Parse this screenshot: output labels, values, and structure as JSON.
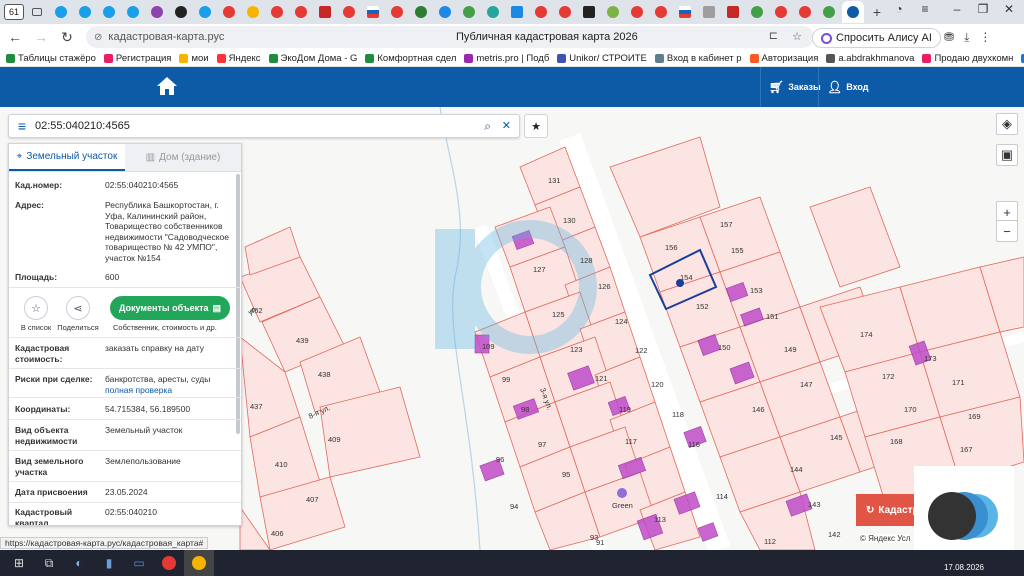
{
  "browser": {
    "tab_count": "61",
    "page_title": "Публичная кадастровая карта 2026",
    "url": "кадастровая-карта.рус",
    "alice_button": "Спросить Алису AI",
    "status_url": "https://кадастровая-карта.рус/кадастровая_карта#"
  },
  "bookmarks": [
    {
      "label": "Таблицы стажёро",
      "color": "#1e8e3e"
    },
    {
      "label": "Регистрация",
      "color": "#e91e63"
    },
    {
      "label": "мои",
      "color": "#f4b400"
    },
    {
      "label": "Яндекс",
      "color": "#ff3333"
    },
    {
      "label": "ЭкоДом Дома - G",
      "color": "#1e8e3e"
    },
    {
      "label": "Комфортная сдел",
      "color": "#1e8e3e"
    },
    {
      "label": "metris.pro | Подб",
      "color": "#9c27b0"
    },
    {
      "label": "Unikor/ СТРОИТЕ",
      "color": "#3f51b5"
    },
    {
      "label": "Вход в кабинет р",
      "color": "#607d8b"
    },
    {
      "label": "Авторизация",
      "color": "#ff5722"
    },
    {
      "label": "a.abdrakhmanova",
      "color": "#555555"
    },
    {
      "label": "Продаю двухкомн",
      "color": "#e91e63"
    },
    {
      "label": "Объект",
      "color": "#1976d2"
    }
  ],
  "header": {
    "orders_label": "Заказы",
    "login_label": "Вход"
  },
  "search": {
    "value": "02:55:040210:4565"
  },
  "panel": {
    "tab_land": "Земельный участок",
    "tab_house": "Дом (здание)",
    "cad_number_label": "Кад.номер:",
    "cad_number": "02:55:040210:4565",
    "address_label": "Адрес:",
    "address": "Республика Башкортостан, г. Уфа, Калининский район, Товарищество собственников недвижимости \"Садоводческое товарищество № 42 УМПО\", участок №154",
    "area_label": "Площадь:",
    "area": "600",
    "in_list": "В список",
    "share": "Поделиться",
    "documents_button": "Документы объекта",
    "documents_sub": "Собственник, стоимость и др.",
    "cad_cost_label": "Кадастровая стоимость:",
    "cad_cost_link": "заказать справку на дату",
    "risks_label": "Риски при сделке:",
    "risks_text": "банкротства, аресты, суды",
    "risks_link": "полная проверка",
    "coords_label": "Координаты:",
    "coords": "54.715384, 56.189500",
    "object_type_label": "Вид объекта недвижимости",
    "object_type": "Земельный участок",
    "land_type_label": "Вид земельного участка",
    "land_type": "Землепользование",
    "assign_date_label": "Дата присвоения",
    "assign_date": "23.05.2024",
    "quarter_label": "Кадастровый квартал",
    "quarter": "02:55:040210"
  },
  "map": {
    "parcels": [
      "131",
      "130",
      "128",
      "127",
      "126",
      "125",
      "124",
      "123",
      "122",
      "121",
      "120",
      "119",
      "118",
      "117",
      "116",
      "157",
      "156",
      "155",
      "154",
      "153",
      "152",
      "151",
      "150",
      "149",
      "147",
      "146",
      "145",
      "144",
      "143",
      "142",
      "114",
      "113",
      "112",
      "109",
      "99",
      "98",
      "97",
      "96",
      "95",
      "94",
      "93",
      "91",
      "462",
      "439",
      "438",
      "437",
      "410",
      "409",
      "407",
      "406",
      "174",
      "173",
      "172",
      "171",
      "170",
      "169",
      "168",
      "167",
      "Green"
    ],
    "streets": [
      "3-я ул.",
      "8-я ул.",
      "ул."
    ],
    "kad_button": "Кадастр",
    "attribution": "© Яндекс Усл"
  },
  "taskbar": {
    "clock": "17.08.2026"
  }
}
